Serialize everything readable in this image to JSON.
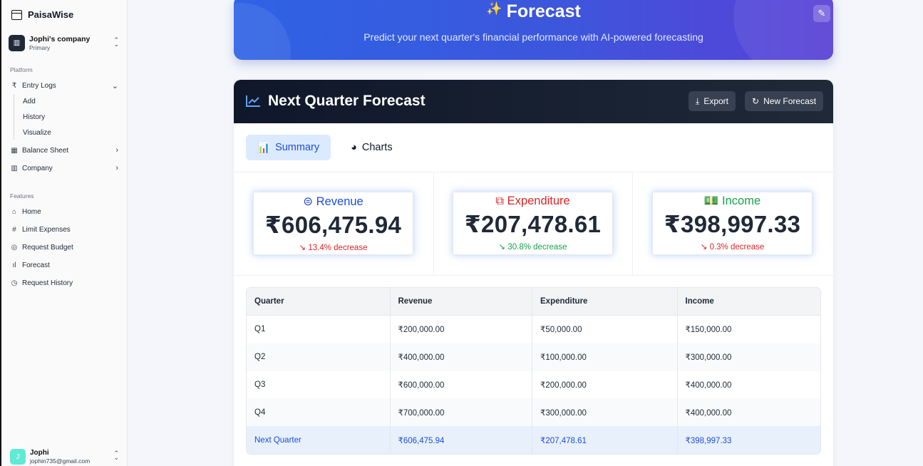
{
  "sidebar": {
    "brand": "PaisaWise",
    "company": {
      "name": "Jophi's company",
      "role": "Primary"
    },
    "platform_label": "Platform",
    "entry_logs": {
      "label": "Entry Logs",
      "sub": [
        "Add",
        "History",
        "Visualize"
      ]
    },
    "balance_sheet": "Balance Sheet",
    "company_menu": "Company",
    "features_label": "Features",
    "features": [
      "Home",
      "Limit Expenses",
      "Request Budget",
      "Forecast",
      "Request History"
    ],
    "user": {
      "initial": "J",
      "name": "Jophi",
      "email": "jophin735@gmail.com"
    }
  },
  "banner": {
    "title": "Forecast",
    "subtitle": "Predict your next quarter's financial performance with AI-powered forecasting"
  },
  "card": {
    "title": "Next Quarter Forecast",
    "export_label": "Export",
    "new_forecast_label": "New Forecast",
    "tabs": {
      "summary": "Summary",
      "charts": "Charts"
    }
  },
  "stats": {
    "revenue": {
      "label": "Revenue",
      "value": "₹606,475.94",
      "change": "13.4% decrease"
    },
    "expenditure": {
      "label": "Expenditure",
      "value": "₹207,478.61",
      "change": "30.8% decrease"
    },
    "income": {
      "label": "Income",
      "value": "₹398,997.33",
      "change": "0.3% decrease"
    }
  },
  "colors": {
    "accent": "#3d56dc",
    "header_dark": "#0f172a",
    "decrease_bad": "#dc2626",
    "decrease_good": "#16a34a"
  },
  "table": {
    "headers": [
      "Quarter",
      "Revenue",
      "Expenditure",
      "Income"
    ],
    "rows": [
      [
        "Q1",
        "₹200,000.00",
        "₹50,000.00",
        "₹150,000.00"
      ],
      [
        "Q2",
        "₹400,000.00",
        "₹100,000.00",
        "₹300,000.00"
      ],
      [
        "Q3",
        "₹600,000.00",
        "₹200,000.00",
        "₹400,000.00"
      ],
      [
        "Q4",
        "₹700,000.00",
        "₹300,000.00",
        "₹400,000.00"
      ],
      [
        "Next Quarter",
        "₹606,475.94",
        "₹207,478.61",
        "₹398,997.33"
      ]
    ]
  }
}
